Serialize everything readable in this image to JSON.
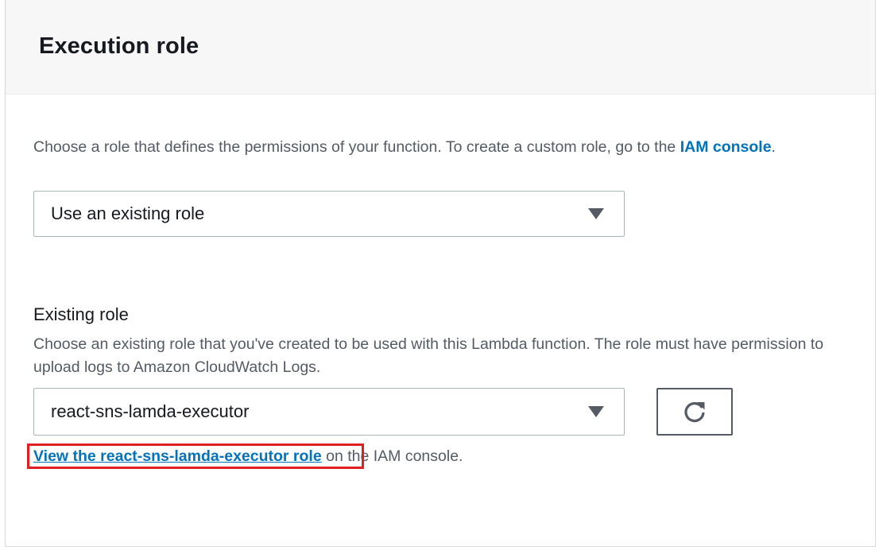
{
  "panel": {
    "title": "Execution role"
  },
  "role_choice": {
    "description_before_link": "Choose a role that defines the permissions of your function. To create a custom role, go to the ",
    "iam_link_label": "IAM console",
    "description_after_link": ".",
    "selected_value": "Use an existing role"
  },
  "existing_role": {
    "label": "Existing role",
    "description": "Choose an existing role that you've created to be used with this Lambda function. The role must have permission to upload logs to Amazon CloudWatch Logs.",
    "selected_value": "react-sns-lamda-executor",
    "refresh_icon": "refresh-icon",
    "view_link_label": "View the react-sns-lamda-executor role",
    "view_link_suffix": " on the IAM console."
  },
  "colors": {
    "link": "#0073bb",
    "highlight": "#e02020",
    "header_bg": "#f7f7f7",
    "muted_text": "#545b64"
  }
}
